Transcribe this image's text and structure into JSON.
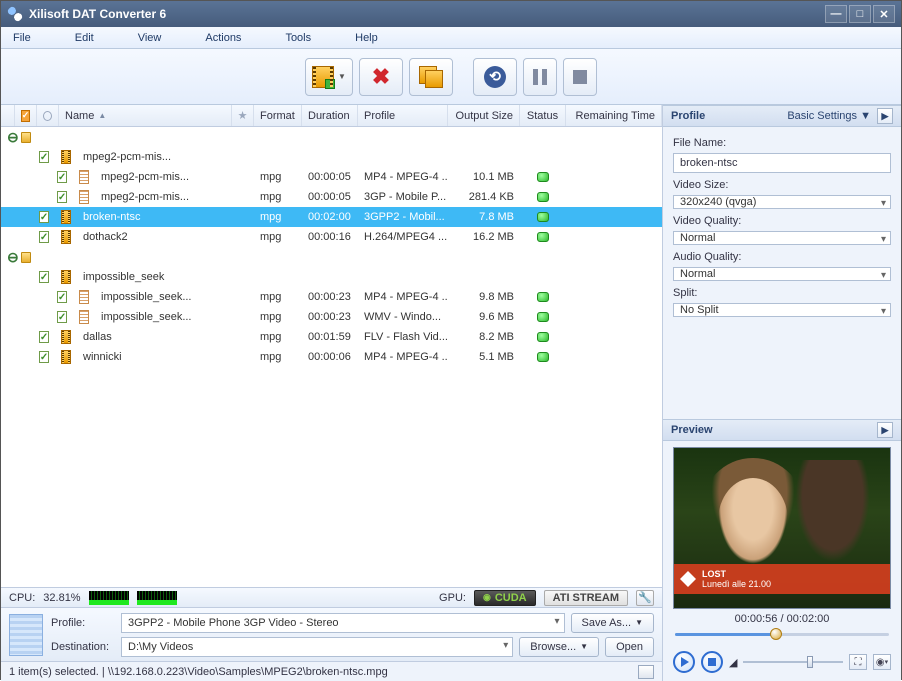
{
  "window": {
    "title": "Xilisoft DAT Converter 6"
  },
  "menu": {
    "file": "File",
    "edit": "Edit",
    "view": "View",
    "actions": "Actions",
    "tools": "Tools",
    "help": "Help"
  },
  "columns": {
    "name": "Name",
    "format": "Format",
    "duration": "Duration",
    "profile": "Profile",
    "output_size": "Output Size",
    "status": "Status",
    "remaining": "Remaining Time"
  },
  "files": [
    {
      "indent": 0,
      "expander": "⊖",
      "type": "folder",
      "name": ""
    },
    {
      "indent": 1,
      "type": "video",
      "name": "mpeg2-pcm-mis...",
      "format": "",
      "duration": "",
      "profile": "",
      "size": "",
      "status": ""
    },
    {
      "indent": 2,
      "type": "doc",
      "name": "mpeg2-pcm-mis...",
      "format": "mpg",
      "duration": "00:00:05",
      "profile": "MP4 - MPEG-4 ...",
      "size": "10.1 MB",
      "status": "ok"
    },
    {
      "indent": 2,
      "type": "doc",
      "name": "mpeg2-pcm-mis...",
      "format": "mpg",
      "duration": "00:00:05",
      "profile": "3GP - Mobile P...",
      "size": "281.4 KB",
      "status": "ok"
    },
    {
      "indent": 1,
      "type": "video",
      "name": "broken-ntsc",
      "format": "mpg",
      "duration": "00:02:00",
      "profile": "3GPP2 - Mobil...",
      "size": "7.8 MB",
      "status": "ok",
      "selected": true
    },
    {
      "indent": 1,
      "type": "video",
      "name": "dothack2",
      "format": "mpg",
      "duration": "00:00:16",
      "profile": "H.264/MPEG4 ...",
      "size": "16.2 MB",
      "status": "ok"
    },
    {
      "indent": 0,
      "expander": "⊖",
      "type": "folder",
      "name": ""
    },
    {
      "indent": 1,
      "type": "video",
      "name": "impossible_seek",
      "format": "",
      "duration": "",
      "profile": "",
      "size": "",
      "status": ""
    },
    {
      "indent": 2,
      "type": "doc",
      "name": "impossible_seek...",
      "format": "mpg",
      "duration": "00:00:23",
      "profile": "MP4 - MPEG-4 ...",
      "size": "9.8 MB",
      "status": "ok"
    },
    {
      "indent": 2,
      "type": "doc",
      "name": "impossible_seek...",
      "format": "mpg",
      "duration": "00:00:23",
      "profile": "WMV - Windo...",
      "size": "9.6 MB",
      "status": "ok"
    },
    {
      "indent": 1,
      "type": "video",
      "name": "dallas",
      "format": "mpg",
      "duration": "00:01:59",
      "profile": "FLV - Flash Vid...",
      "size": "8.2 MB",
      "status": "ok"
    },
    {
      "indent": 1,
      "type": "video",
      "name": "winnicki",
      "format": "mpg",
      "duration": "00:00:06",
      "profile": "MP4 - MPEG-4 ...",
      "size": "5.1 MB",
      "status": "ok"
    }
  ],
  "cpu": {
    "label": "CPU:",
    "value": "32.81%"
  },
  "gpu": {
    "label": "GPU:",
    "cuda": "CUDA",
    "ati": "ATI STREAM"
  },
  "profilebar": {
    "profile_label": "Profile:",
    "profile_value": "3GPP2 - Mobile Phone 3GP Video - Stereo",
    "dest_label": "Destination:",
    "dest_value": "D:\\My Videos",
    "saveas": "Save As...",
    "browse": "Browse...",
    "open": "Open"
  },
  "statusline": "1 item(s) selected. | \\\\192.168.0.223\\Video\\Samples\\MPEG2\\broken-ntsc.mpg",
  "profile_panel": {
    "title": "Profile",
    "basic": "Basic Settings",
    "filename_label": "File Name:",
    "filename": "broken-ntsc",
    "videosize_label": "Video Size:",
    "videosize": "320x240 (qvga)",
    "vq_label": "Video Quality:",
    "vq": "Normal",
    "aq_label": "Audio Quality:",
    "aq": "Normal",
    "split_label": "Split:",
    "split": "No Split"
  },
  "preview": {
    "title": "Preview",
    "lost": "LOST",
    "lost_sub": "Lunedì alle 21.00",
    "time": "00:00:56 / 00:02:00",
    "progress_pct": 47,
    "volume_pct": 64
  }
}
